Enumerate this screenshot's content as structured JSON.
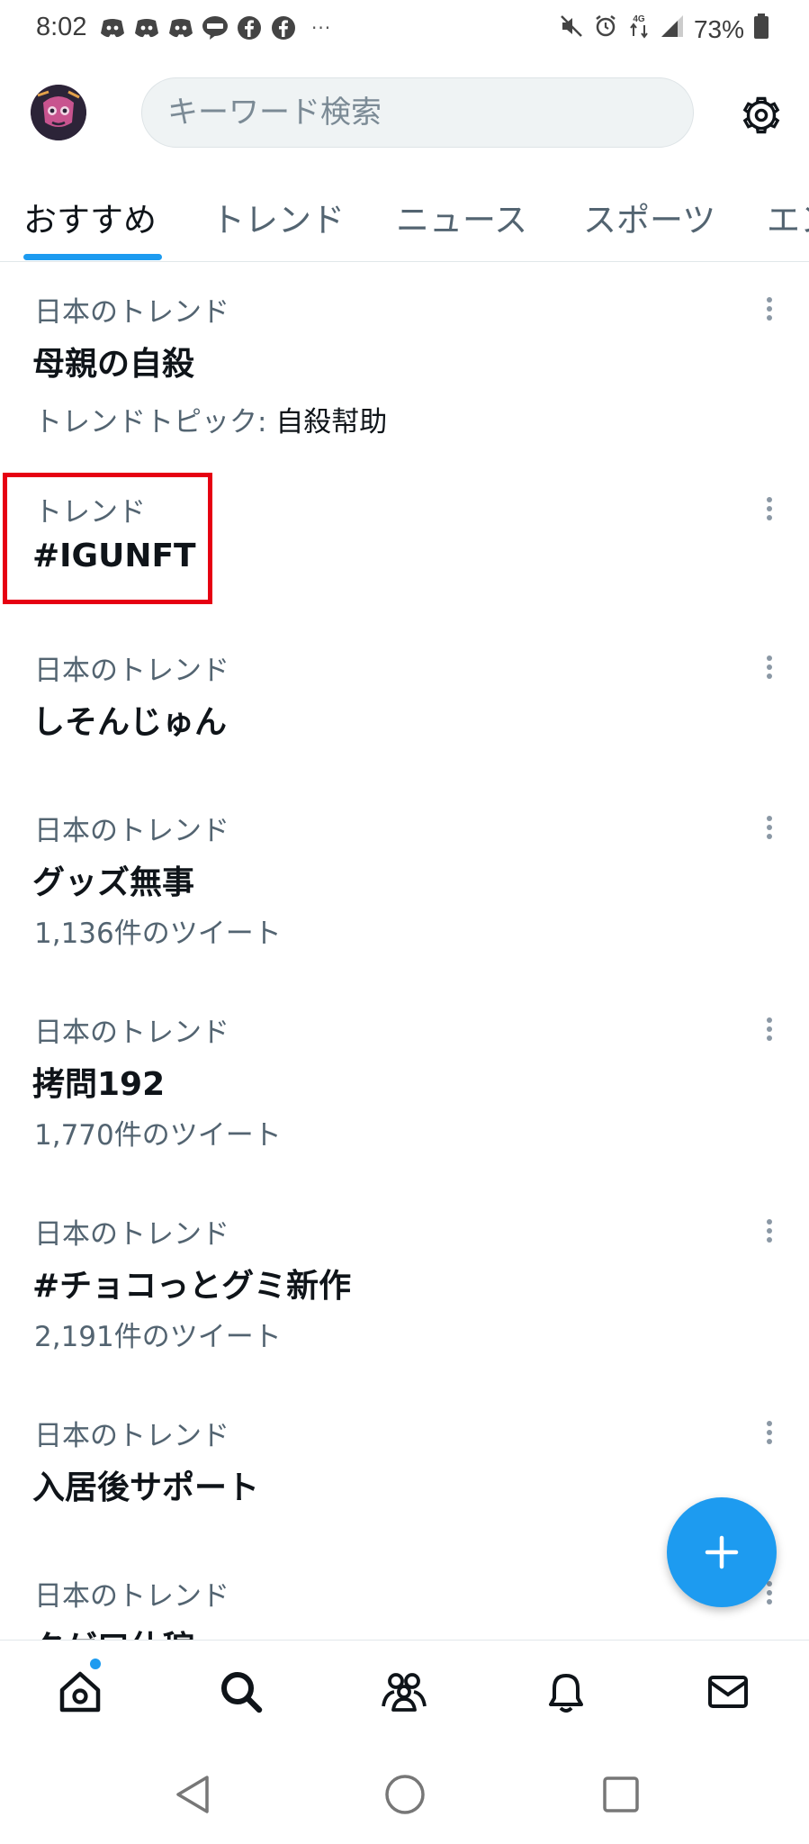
{
  "status_bar": {
    "time": "8:02",
    "battery": "73%",
    "network": "4G",
    "notification_icons": [
      "discord-icon",
      "discord-icon",
      "discord-icon",
      "line-icon",
      "facebook-icon",
      "facebook-icon"
    ],
    "overflow": "···"
  },
  "header": {
    "search_placeholder": "キーワード検索"
  },
  "tabs": [
    {
      "label": "おすすめ",
      "active": true
    },
    {
      "label": "トレンド",
      "active": false
    },
    {
      "label": "ニュース",
      "active": false
    },
    {
      "label": "スポーツ",
      "active": false
    },
    {
      "label": "エン",
      "active": false
    }
  ],
  "trends": [
    {
      "context": "日本のトレンド",
      "title": "母親の自殺",
      "meta_label": "トレンドトピック: ",
      "meta_value": "自殺幇助"
    },
    {
      "context": "トレンド",
      "title": "#IGUNFT"
    },
    {
      "context": "日本のトレンド",
      "title": "しそんじゅん"
    },
    {
      "context": "日本のトレンド",
      "title": "グッズ無事",
      "meta": "1,136件のツイート"
    },
    {
      "context": "日本のトレンド",
      "title": "拷問192",
      "meta": "1,770件のツイート"
    },
    {
      "context": "日本のトレンド",
      "title": "#チョコっとグミ新作",
      "meta": "2,191件のツイート"
    },
    {
      "context": "日本のトレンド",
      "title": "入居後サポート"
    },
    {
      "context": "日本のトレンド",
      "title": "タゲ口仕稼"
    }
  ],
  "colors": {
    "accent": "#1d9bf0",
    "highlight": "#e60012",
    "secondary_text": "#536471",
    "primary_text": "#0f1419"
  },
  "fab": {
    "icon": "plus-icon"
  },
  "bottom_nav": [
    "home-icon",
    "search-icon",
    "communities-icon",
    "notifications-bell-icon",
    "messages-envelope-icon"
  ],
  "system_nav": [
    "back-triangle-icon",
    "home-circle-icon",
    "recents-square-icon"
  ]
}
